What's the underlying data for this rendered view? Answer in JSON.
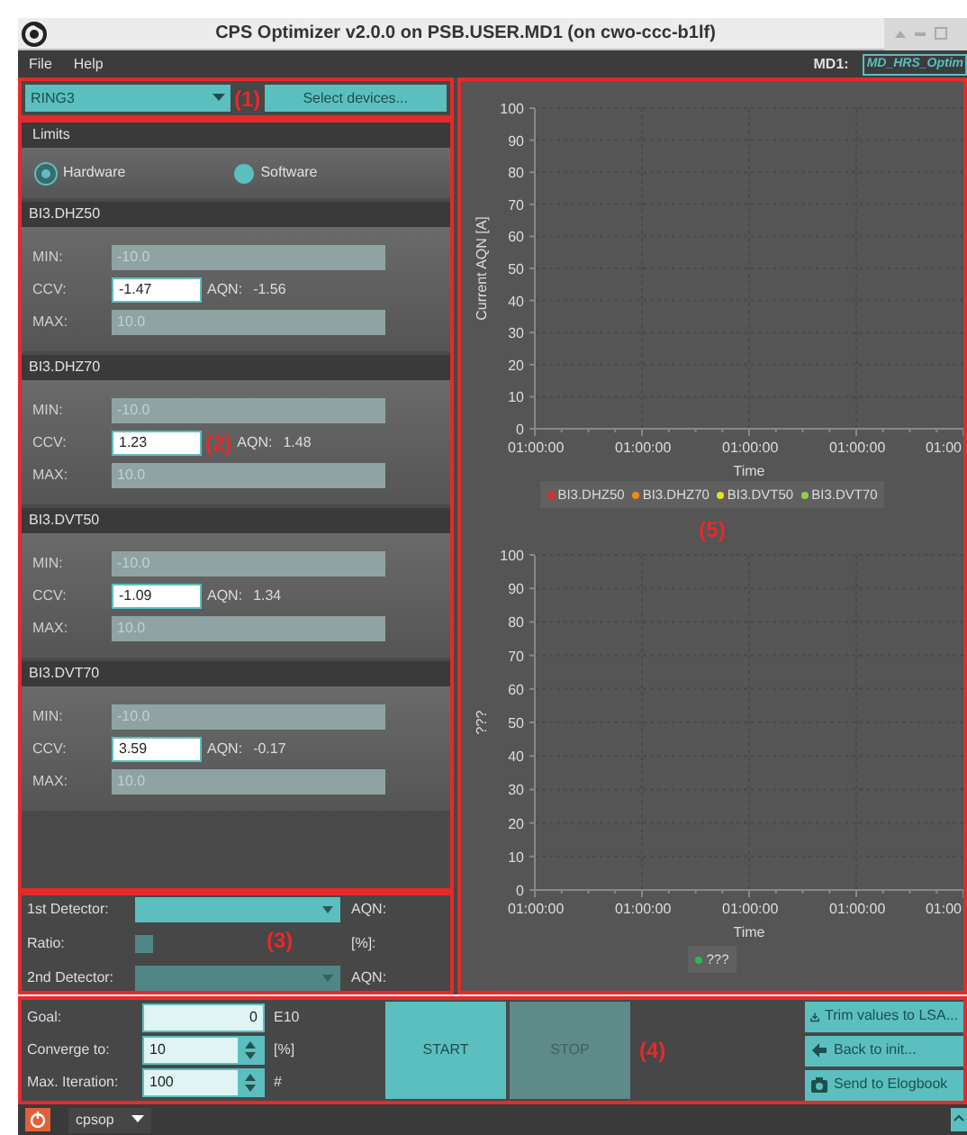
{
  "window": {
    "title": "CPS Optimizer v2.0.0 on PSB.USER.MD1 (on cwo-ccc-b1lf)"
  },
  "menu": [
    "File",
    "Help"
  ],
  "md_selector": {
    "label": "MD1:",
    "value": "MD_HRS_Optim"
  },
  "device_bar": {
    "ring": "RING3",
    "button": "Select devices...",
    "annotation": "(1)"
  },
  "limits": {
    "title": "Limits",
    "options": [
      {
        "label": "Hardware",
        "selected": true
      },
      {
        "label": "Software",
        "selected": false
      }
    ],
    "devices": [
      {
        "name": "BI3.DHZ50",
        "min_label": "MIN:",
        "min": "-10.0",
        "ccv_label": "CCV:",
        "ccv": "-1.47",
        "aqn_label": "AQN:",
        "aqn": "-1.56",
        "max_label": "MAX:",
        "max": "10.0"
      },
      {
        "name": "BI3.DHZ70",
        "min_label": "MIN:",
        "min": "-10.0",
        "ccv_label": "CCV:",
        "ccv": "1.23",
        "annotation": "(2)",
        "aqn_label": "AQN:",
        "aqn": "1.48",
        "max_label": "MAX:",
        "max": "10.0"
      },
      {
        "name": "BI3.DVT50",
        "min_label": "MIN:",
        "min": "-10.0",
        "ccv_label": "CCV:",
        "ccv": "-1.09",
        "aqn_label": "AQN:",
        "aqn": "1.34",
        "max_label": "MAX:",
        "max": "10.0"
      },
      {
        "name": "BI3.DVT70",
        "min_label": "MIN:",
        "min": "-10.0",
        "ccv_label": "CCV:",
        "ccv": "3.59",
        "aqn_label": "AQN:",
        "aqn": "-0.17",
        "max_label": "MAX:",
        "max": "10.0"
      }
    ]
  },
  "detectors": {
    "annotation": "(3)",
    "rows": [
      {
        "kind": "combo",
        "label": "1st Detector:",
        "disabled": false,
        "unit": "AQN:"
      },
      {
        "kind": "checkbox",
        "label": "Ratio:",
        "checked": false,
        "unit": "[%]:"
      },
      {
        "kind": "combo",
        "label": "2nd Detector:",
        "disabled": true,
        "unit": "AQN:"
      }
    ]
  },
  "controls": {
    "annotation": "(4)",
    "fields": [
      {
        "kind": "text",
        "label": "Goal:",
        "value": "0",
        "unit": "E10"
      },
      {
        "kind": "spinner",
        "label": "Converge to:",
        "value": "10",
        "unit": "[%]"
      },
      {
        "kind": "spinner",
        "label": "Max. Iteration:",
        "value": "100",
        "unit": "#"
      }
    ],
    "buttons": [
      {
        "label": "START",
        "disabled": false
      },
      {
        "label": "STOP",
        "disabled": true
      }
    ],
    "actions": [
      {
        "kind": "trim",
        "label": "Trim values to LSA..."
      },
      {
        "kind": "back",
        "label": "Back to init..."
      },
      {
        "kind": "camera",
        "label": "Send to Elogbook"
      }
    ]
  },
  "plots": {
    "annotation": "(5)",
    "charts": [
      {
        "chart_data": {
          "type": "line",
          "xlabel": "Time",
          "ylabel": "Current AQN [A]",
          "ylim": [
            0,
            100
          ],
          "yticks": [
            0,
            10,
            20,
            30,
            40,
            50,
            60,
            70,
            80,
            90,
            100
          ],
          "grid": true,
          "categories": [
            "01:00:00",
            "01:00:00",
            "01:00:00",
            "01:00:00",
            "01:00"
          ],
          "series": [
            {
              "name": "BI3.DHZ50",
              "color": "#e52a2a",
              "values": [
                null,
                null,
                null,
                null,
                null
              ]
            },
            {
              "name": "BI3.DHZ70",
              "color": "#f08a1c",
              "values": [
                null,
                null,
                null,
                null,
                null
              ]
            },
            {
              "name": "BI3.DVT50",
              "color": "#e8e020",
              "values": [
                null,
                null,
                null,
                null,
                null
              ]
            },
            {
              "name": "BI3.DVT70",
              "color": "#8fd04a",
              "values": [
                null,
                null,
                null,
                null,
                null
              ]
            }
          ]
        }
      },
      {
        "chart_data": {
          "type": "line",
          "xlabel": "Time",
          "ylabel": "???",
          "ylim": [
            0,
            100
          ],
          "yticks": [
            0,
            10,
            20,
            30,
            40,
            50,
            60,
            70,
            80,
            90,
            100
          ],
          "grid": true,
          "categories": [
            "01:00:00",
            "01:00:00",
            "01:00:00",
            "01:00:00",
            "01:00"
          ],
          "series": [
            {
              "name": "???",
              "color": "#2fb84a",
              "values": [
                null,
                null,
                null,
                null,
                null
              ]
            }
          ]
        }
      }
    ]
  },
  "taskbar": {
    "app": "cpsop"
  }
}
